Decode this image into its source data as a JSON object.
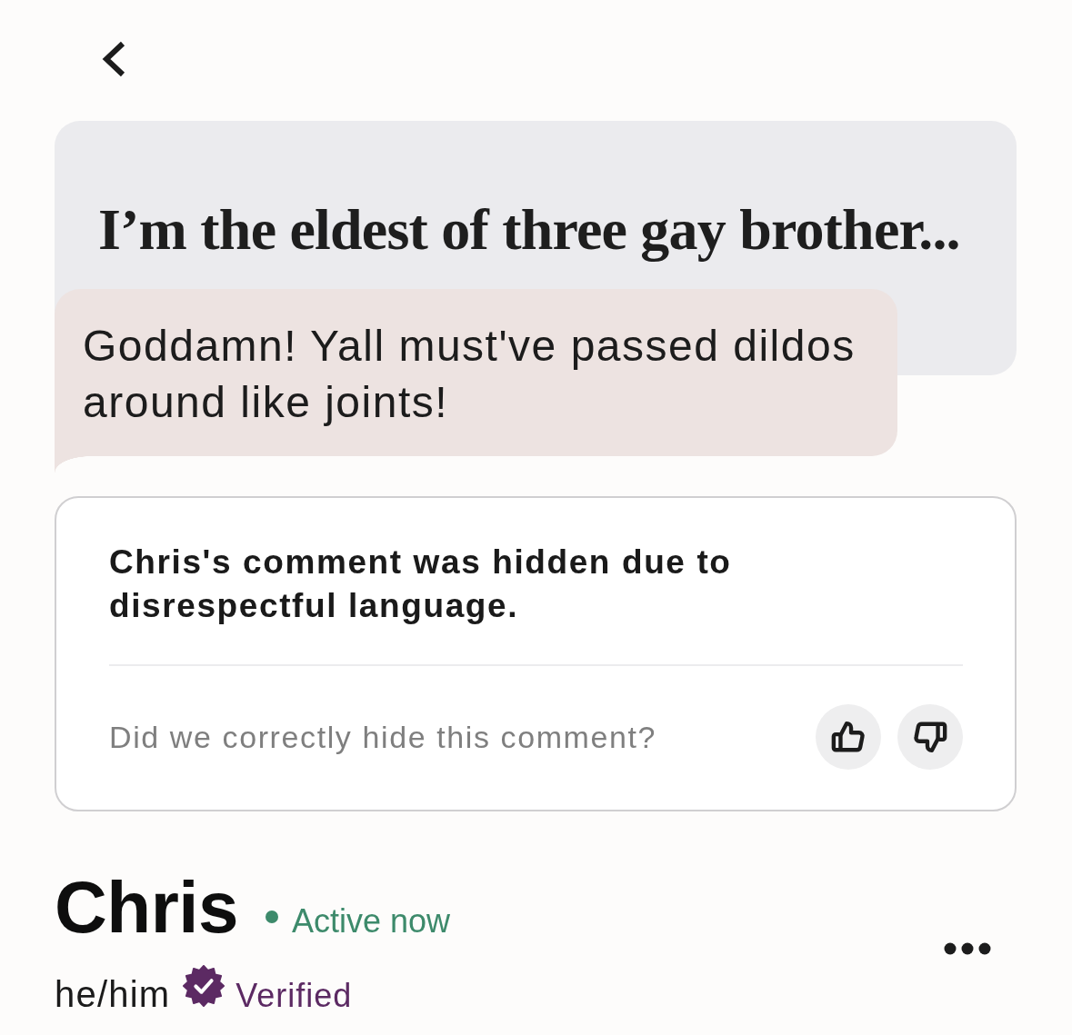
{
  "prompt": {
    "title": "I’m the eldest of three gay brother..."
  },
  "reply": {
    "text": "Goddamn! Yall must've passed dildos around like joints!"
  },
  "moderation_notice": {
    "message": "Chris's comment was hidden due to disrespectful language.",
    "question": "Did we correctly hide this comment?",
    "feedback": [
      {
        "kind": "thumbs_up",
        "selected": false
      },
      {
        "kind": "thumbs_down",
        "selected": false
      }
    ]
  },
  "profile": {
    "name": "Chris",
    "online": true,
    "status": "Active now",
    "pronouns": "he/him",
    "verified": true,
    "verification": "Verified"
  }
}
